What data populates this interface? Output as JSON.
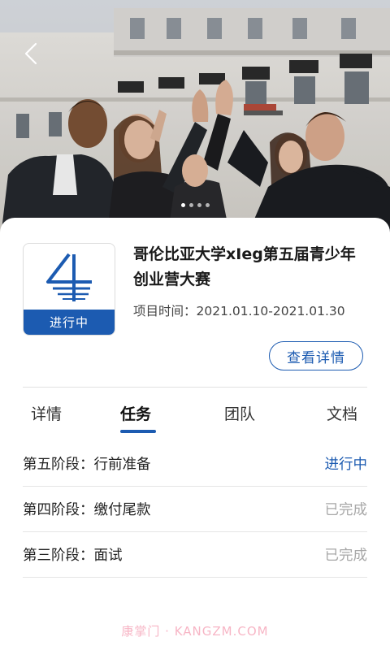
{
  "banner": {
    "back_icon": "chevron-left-icon",
    "image_description_icon": "group-high-five-photo",
    "slide_count": 4,
    "active_slide": 1
  },
  "project": {
    "title": "哥伦比亚大学xIeg第五届青少年创业营大赛",
    "time_label": "项目时间：",
    "time_range": "2021.01.10-2021.01.30",
    "status": "进行中",
    "detail_button": "查看详情",
    "accent_color": "#1c5bb1"
  },
  "tabs": [
    {
      "label": "详情"
    },
    {
      "label": "任务"
    },
    {
      "label": "团队"
    },
    {
      "label": "文档"
    }
  ],
  "active_tab": "任务",
  "tasks": [
    {
      "name": "第五阶段：行前准备",
      "status": "进行中"
    },
    {
      "name": "第四阶段：缴付尾款",
      "status": "已完成"
    },
    {
      "name": "第三阶段：面试",
      "status": "已完成"
    }
  ],
  "watermark": "康掌门 · KANGZM.COM"
}
